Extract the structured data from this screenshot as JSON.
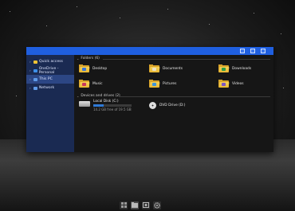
{
  "window": {
    "controls": [
      "minimize-icon",
      "maximize-icon",
      "close-icon"
    ]
  },
  "sidebar": {
    "items": [
      {
        "label": "Quick access",
        "icon": "star-icon",
        "color": "#f2c335"
      },
      {
        "label": "OneDrive - Personal",
        "icon": "cloud-icon",
        "color": "#3d8ee8"
      },
      {
        "label": "This PC",
        "icon": "computer-icon",
        "color": "#5f9ae8",
        "selected": true
      },
      {
        "label": "Network",
        "icon": "network-icon",
        "color": "#5f9ae8"
      }
    ]
  },
  "folders": {
    "header": "Folders (6)",
    "items": [
      {
        "label": "Desktop",
        "badge_color": "#3a76d6"
      },
      {
        "label": "Documents",
        "badge_color": "#e9e1c4"
      },
      {
        "label": "Downloads",
        "badge_color": "#2e9d4a"
      },
      {
        "label": "Music",
        "badge_color": "#c8375c"
      },
      {
        "label": "Pictures",
        "badge_color": "#3f95d9"
      },
      {
        "label": "Videos",
        "badge_color": "#7d56c2"
      }
    ]
  },
  "devices": {
    "header": "Devices and drives (2)",
    "local_disk": {
      "label": "Local Disk (C:)",
      "free": "14.2 GB free of 19.5 GB",
      "used_fraction": 0.27
    },
    "dvd": {
      "label": "DVD Drive (D:)"
    }
  },
  "taskbar": {
    "items": [
      "start-icon",
      "file-explorer-icon",
      "photos-icon",
      "settings-icon"
    ]
  },
  "colors": {
    "accent": "#1f5fe0",
    "sidebar_bg": "#1a2a52",
    "content_bg": "#161616"
  }
}
